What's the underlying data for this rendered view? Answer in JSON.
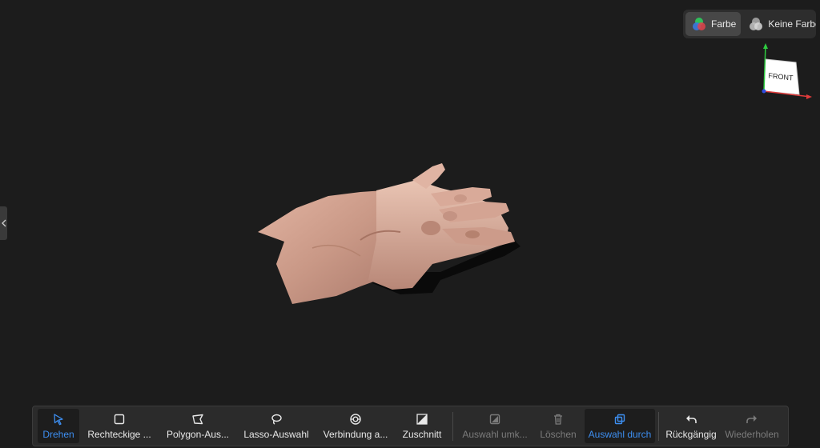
{
  "color_mode": {
    "options": [
      {
        "label": "Farbe",
        "icon": "color-circles-icon",
        "active": true
      },
      {
        "label": "Keine Farbe",
        "icon": "gray-circles-icon",
        "active": false
      }
    ]
  },
  "view_cube": {
    "face_label": "FRONT"
  },
  "toolbar": {
    "tools": [
      {
        "label": "Drehen",
        "icon": "rotate-cursor-icon",
        "state": "active"
      },
      {
        "label": "Rechteckige ...",
        "icon": "rectangle-select-icon",
        "state": "normal"
      },
      {
        "label": "Polygon-Aus...",
        "icon": "polygon-select-icon",
        "state": "normal"
      },
      {
        "label": "Lasso-Auswahl",
        "icon": "lasso-select-icon",
        "state": "normal"
      },
      {
        "label": "Verbindung a...",
        "icon": "connected-select-icon",
        "state": "normal"
      },
      {
        "label": "Zuschnitt",
        "icon": "crop-icon",
        "state": "normal"
      },
      {
        "label": "Auswahl umk...",
        "icon": "invert-selection-icon",
        "state": "disabled"
      },
      {
        "label": "Löschen",
        "icon": "trash-icon",
        "state": "disabled"
      },
      {
        "label": "Auswahl durch",
        "icon": "select-through-icon",
        "state": "active"
      },
      {
        "label": "Rückgängig",
        "icon": "undo-icon",
        "state": "normal"
      },
      {
        "label": "Wiederholen",
        "icon": "redo-icon",
        "state": "disabled"
      }
    ]
  },
  "colors": {
    "accent": "#3d8ff2",
    "background": "#1c1c1c",
    "toolbar": "#2b2b2b"
  }
}
